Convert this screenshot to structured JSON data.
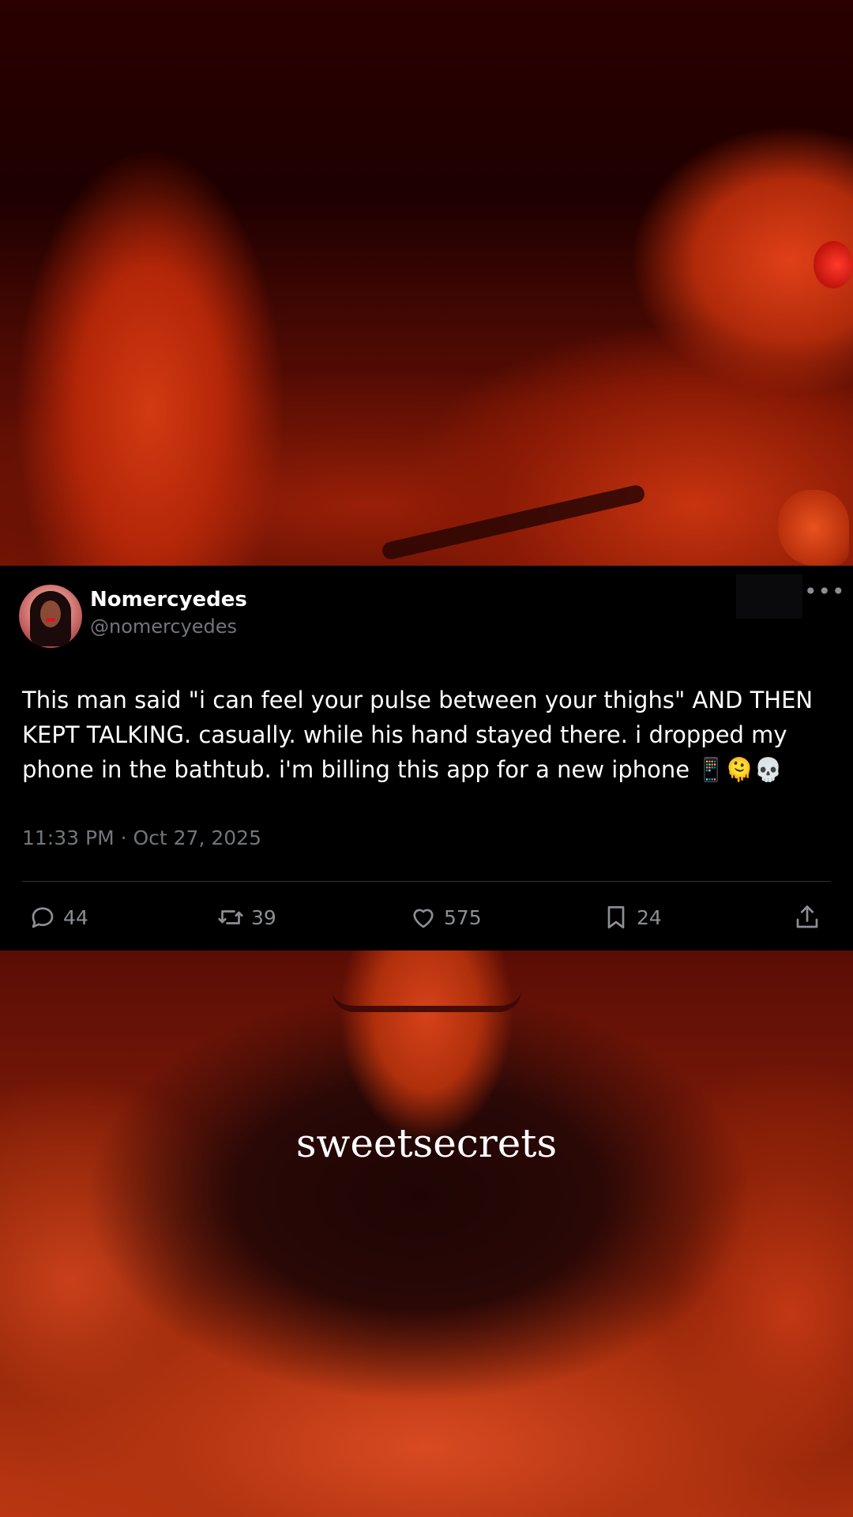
{
  "tweet": {
    "display_name": "Nomercyedes",
    "handle": "@nomercyedes",
    "text": "This man said \"i can feel your pulse between your thighs\" AND THEN KEPT TALKING. casually. while his hand stayed there. i dropped my phone in the bathtub. i'm billing this app for a new iphone 📱🫠💀",
    "timestamp": "11:33 PM · Oct 27, 2025",
    "actions": {
      "replies": "44",
      "retweets": "39",
      "likes": "575",
      "bookmarks": "24"
    }
  },
  "watermark": "sweetsecrets",
  "icons": [
    "more-icon",
    "reply-icon",
    "retweet-icon",
    "like-icon",
    "bookmark-icon",
    "share-icon"
  ],
  "colors": {
    "background": "#000000",
    "text_primary": "#ffffff",
    "text_secondary": "#71767b",
    "divider": "#2f3336",
    "photo_tint": "#b32608"
  }
}
